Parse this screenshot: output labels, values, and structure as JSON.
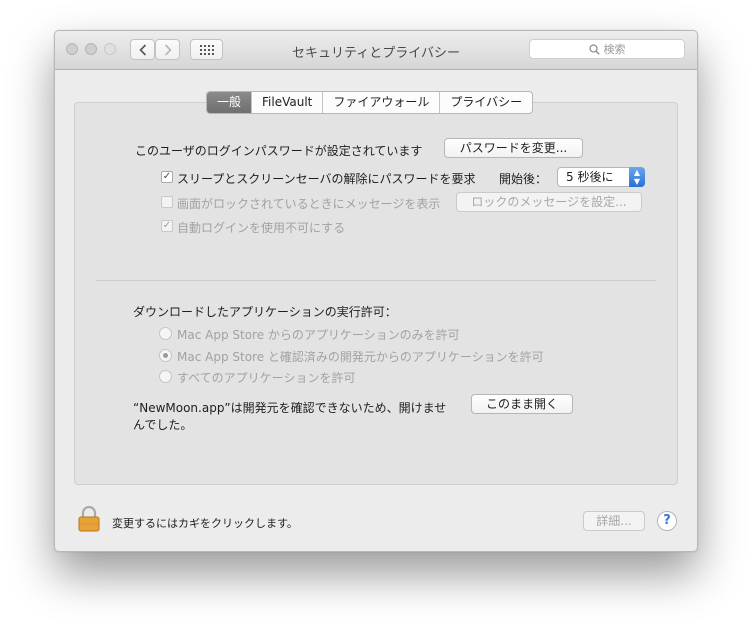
{
  "window": {
    "title": "セキュリティとプライバシー"
  },
  "toolbar": {
    "back_icon": "chevron-left-icon",
    "forward_icon": "chevron-right-icon",
    "grid_icon": "grid-icon",
    "search_placeholder": "検索"
  },
  "tabs": [
    {
      "label": "一般",
      "active": true
    },
    {
      "label": "FileVault",
      "active": false
    },
    {
      "label": "ファイアウォール",
      "active": false
    },
    {
      "label": "プライバシー",
      "active": false
    }
  ],
  "general": {
    "password_text": "このユーザのログインパスワードが設定されています",
    "change_password_button": "パスワードを変更...",
    "require_password_label": "スリープとスクリーンセーバの解除にパスワードを要求",
    "require_password_checked": true,
    "after_label": "開始後：",
    "after_value": "5 秒後に",
    "show_message_label": "画面がロックされているときにメッセージを表示",
    "show_message_checked": false,
    "set_message_button": "ロックのメッセージを設定...",
    "disable_autologin_label": "自動ログインを使用不可にする",
    "disable_autologin_checked": true
  },
  "downloads": {
    "heading": "ダウンロードしたアプリケーションの実行許可：",
    "options": [
      {
        "label": "Mac App Store からのアプリケーションのみを許可",
        "selected": false
      },
      {
        "label": "Mac App Store と確認済みの開発元からのアプリケーションを許可",
        "selected": true
      },
      {
        "label": "すべてのアプリケーションを許可",
        "selected": false
      }
    ],
    "blocked_line1": "“NewMoon.app”は開発元を確認できないため、開けませ",
    "blocked_line2": "んでした。",
    "open_anyway_button": "このまま開く"
  },
  "footer": {
    "lock_text": "変更するにはカギをクリックします。",
    "advanced_button": "詳細...",
    "help_button": "?"
  }
}
